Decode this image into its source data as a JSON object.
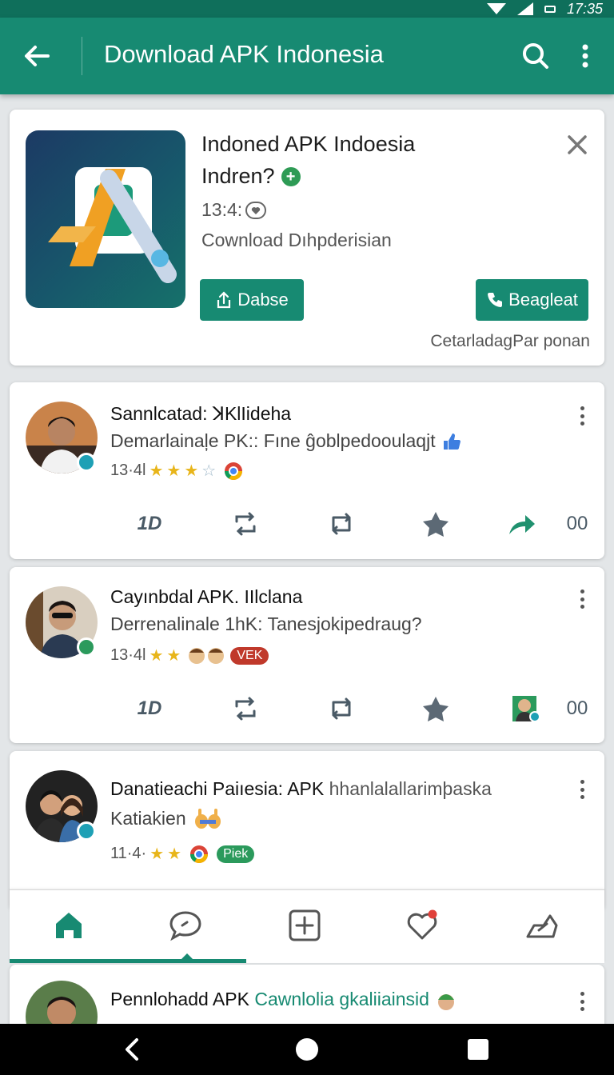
{
  "status_bar": {
    "time": "17:35"
  },
  "app_bar": {
    "title": "Download APK Indonesia"
  },
  "promo": {
    "title": "Indoned APK Indoesia",
    "subtitle": "Indren?",
    "time": "13:4:",
    "description": "Cownload Dıhpderisian",
    "button_left_label": "Dabse",
    "button_right_label": "Beagleat",
    "footer": "CetarladagPar ponan"
  },
  "posts": [
    {
      "title": "Sannlcatad: ꓘKlIideha",
      "subtitle": "Demarlainaļe PK:: Fıne ĝoblpedooulaqjt",
      "meta": "13·4l",
      "stars": 3,
      "count_label": "00",
      "first_action": "1D"
    },
    {
      "title": "Cayınbdal APK. IIlclana",
      "subtitle": "Derrenalinale 1hK: Tanesjokipedraug?",
      "meta": "13·4l",
      "stars": 2,
      "badge": "VEK",
      "count_label": "00",
      "first_action": "1D"
    },
    {
      "title": "Danatieachi Paiıesia: APK",
      "title_tail": "hhanlalallarimþaska",
      "subtitle": "Katiakien",
      "meta": "11·4·",
      "stars": 2,
      "badge": "Piek"
    },
    {
      "title": "Pennlohadd APK",
      "title_accent": "Cawnlolia gkaliiainsid"
    }
  ],
  "colors": {
    "primary": "#178a72",
    "status_bar": "#0f6f5b",
    "star": "#e8b51a",
    "verified": "#1ea0b5"
  },
  "icons": {
    "nav": [
      "home-icon",
      "chat-icon",
      "add-icon",
      "heart-icon",
      "share-icon"
    ],
    "actions": [
      "reply-icon",
      "repost-icon",
      "loop-icon",
      "star-icon",
      "share-arrow-icon"
    ]
  }
}
